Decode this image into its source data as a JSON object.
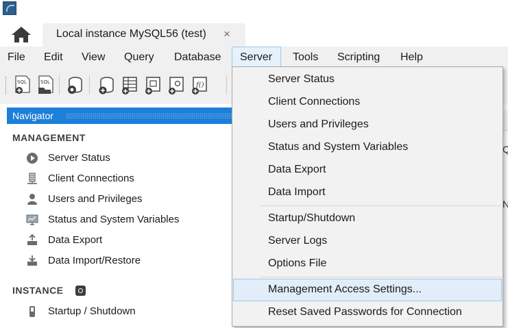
{
  "tabs": {
    "connection_label": "Local instance MySQL56 (test)",
    "close_glyph": "×"
  },
  "menubar": {
    "items": [
      "File",
      "Edit",
      "View",
      "Query",
      "Database",
      "Server",
      "Tools",
      "Scripting",
      "Help"
    ],
    "active": "Server"
  },
  "sidebar": {
    "header": "Navigator",
    "management_label": "MANAGEMENT",
    "management_items": [
      {
        "label": "Server Status",
        "icon": "play-circle-icon"
      },
      {
        "label": "Client Connections",
        "icon": "server-connections-icon"
      },
      {
        "label": "Users and Privileges",
        "icon": "user-icon"
      },
      {
        "label": "Status and System Variables",
        "icon": "monitor-icon"
      },
      {
        "label": "Data Export",
        "icon": "export-icon"
      },
      {
        "label": "Data Import/Restore",
        "icon": "import-icon"
      }
    ],
    "instance_label": "INSTANCE",
    "instance_items": [
      {
        "label": "Startup / Shutdown",
        "icon": "power-switch-icon"
      }
    ]
  },
  "right_pane": {
    "glyph_q": "Q",
    "glyph_n": "N"
  },
  "server_menu": {
    "items": [
      {
        "label": "Server Status"
      },
      {
        "label": "Client Connections"
      },
      {
        "label": "Users and Privileges"
      },
      {
        "label": "Status and System Variables"
      },
      {
        "label": "Data Export"
      },
      {
        "label": "Data Import"
      },
      {
        "label": "Startup/Shutdown"
      },
      {
        "label": "Server Logs"
      },
      {
        "label": "Options File"
      },
      {
        "label": "Management Access Settings...",
        "highlighted": true
      },
      {
        "label": "Reset Saved Passwords for Connection"
      }
    ]
  },
  "colors": {
    "navigator_blue": "#1c7fd9",
    "menu_highlight": "#e1eef9",
    "menu_highlight_border": "#9ec6e8"
  }
}
